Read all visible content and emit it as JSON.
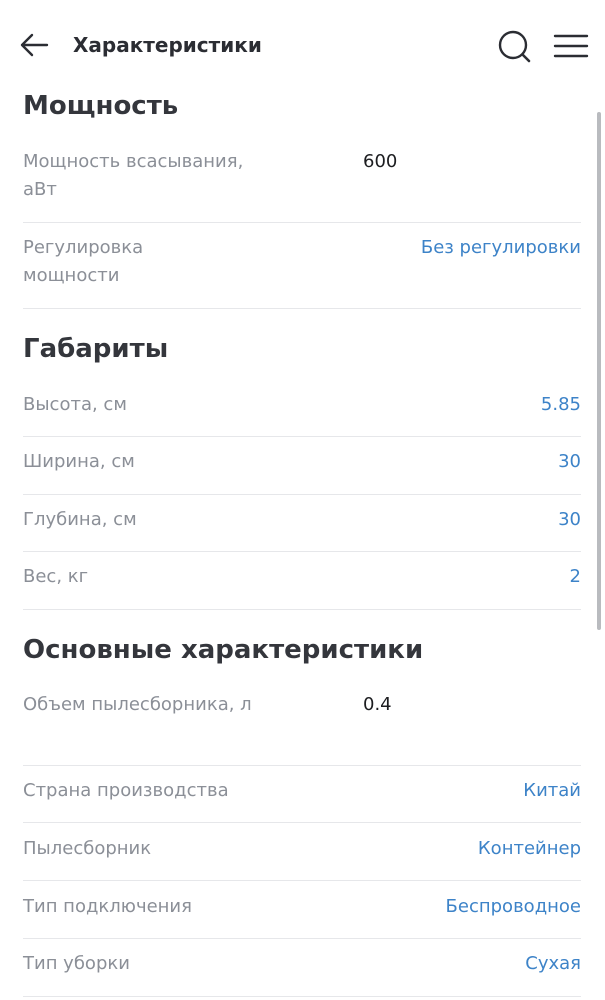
{
  "header": {
    "title": "Характеристики",
    "back_icon": "arrow-left-icon",
    "search_icon": "search-icon",
    "menu_icon": "hamburger-menu-icon"
  },
  "sections": [
    {
      "title": "Мощность",
      "rows": [
        {
          "label": "Мощность всасывания, аВт",
          "value": "600",
          "link": false
        },
        {
          "label": "Регулировка мощности",
          "value": "Без регулировки",
          "link": true
        }
      ]
    },
    {
      "title": "Габариты",
      "rows": [
        {
          "label": "Высота, см",
          "value": "5.85",
          "link": true
        },
        {
          "label": "Ширина, см",
          "value": "30",
          "link": true
        },
        {
          "label": "Глубина, см",
          "value": "30",
          "link": true
        },
        {
          "label": "Вес, кг",
          "value": "2",
          "link": true
        }
      ]
    },
    {
      "title": "Основные характеристики",
      "rows": [
        {
          "label": "Объем пылесборника, л",
          "value": "0.4",
          "link": false
        },
        {
          "label": "Страна производства",
          "value": "Китай",
          "link": true
        },
        {
          "label": "Пылесборник",
          "value": "Контейнер",
          "link": true
        },
        {
          "label": "Тип подключения",
          "value": "Беспроводное",
          "link": true
        },
        {
          "label": "Тип уборки",
          "value": "Сухая",
          "link": true
        }
      ]
    }
  ],
  "colors": {
    "link": "#3d83c8",
    "label": "#8b8f97",
    "title": "#2b2d33"
  }
}
